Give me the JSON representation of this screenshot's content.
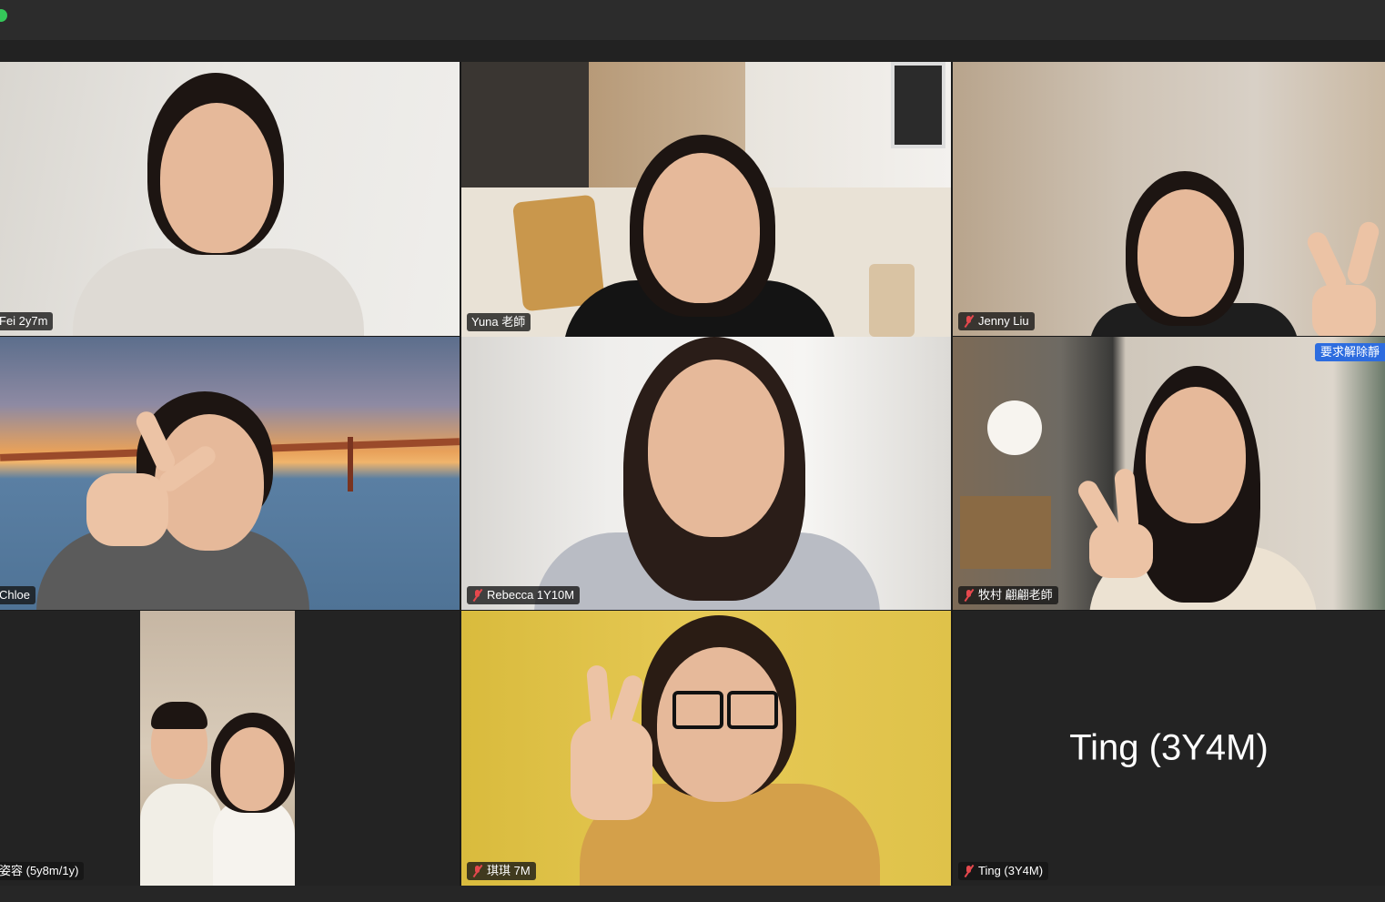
{
  "colors": {
    "active_speaker_border": "#4cc63d",
    "muted_icon": "#e5484d",
    "unmute_request_badge": "#2d6cdf",
    "window_bar": "#2c2c2c"
  },
  "participants": [
    {
      "name": "Fei 2y7m",
      "muted": false,
      "video": true
    },
    {
      "name": "Yuna 老師",
      "muted": false,
      "video": true,
      "active_speaker": true
    },
    {
      "name": "Jenny Liu",
      "muted": true,
      "video": true
    },
    {
      "name": "Chloe",
      "muted": false,
      "video": true
    },
    {
      "name": "Rebecca 1Y10M",
      "muted": true,
      "video": true
    },
    {
      "name": "牧村 翩翩老師",
      "muted": true,
      "video": true,
      "badge": "要求解除靜"
    },
    {
      "name": "姿容 (5y8m/1y)",
      "muted": false,
      "video": true
    },
    {
      "name": "琪琪 7M",
      "muted": true,
      "video": true
    },
    {
      "name": "Ting (3Y4M)",
      "muted": true,
      "video": false,
      "display_name": "Ting (3Y4M)"
    }
  ]
}
